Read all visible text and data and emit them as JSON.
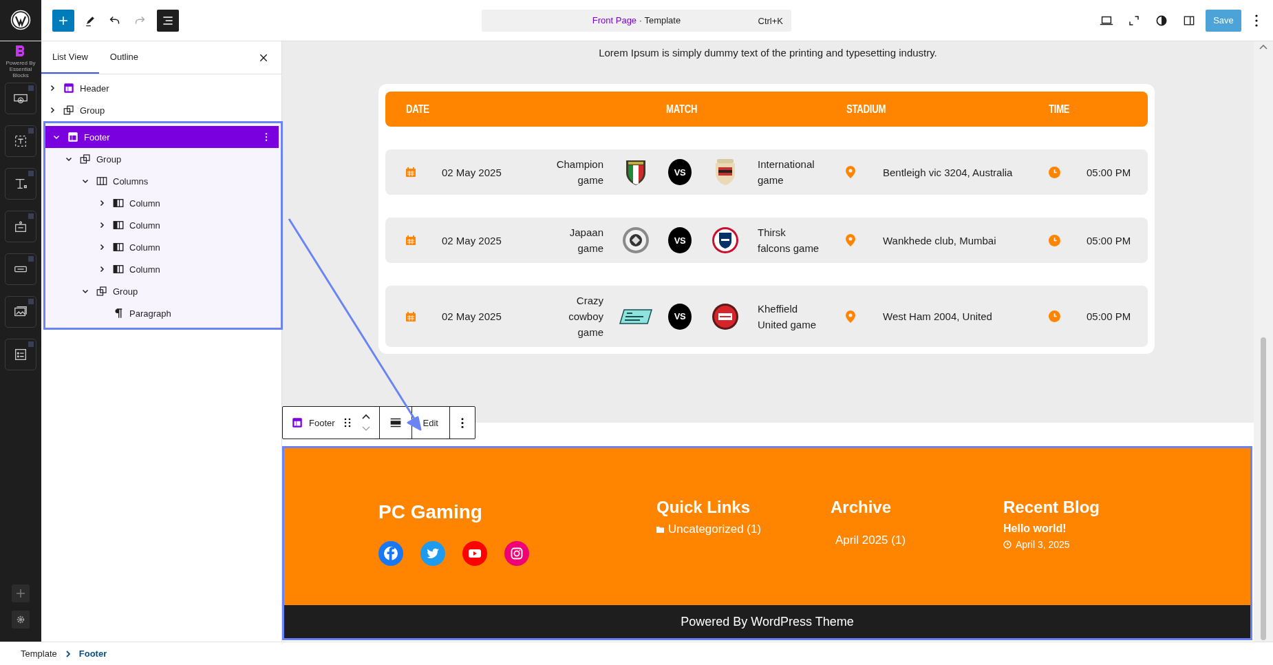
{
  "topbar": {
    "command": {
      "title": "Front Page",
      "type": "· Template",
      "shortcut": "Ctrl+K"
    },
    "redo": {
      "disabled": true
    },
    "list_view_toggle": {
      "pressed": true
    },
    "save": {
      "label": "Save",
      "disabled": true
    }
  },
  "rail": {
    "brand": "Powered By Essential Blocks"
  },
  "list_view": {
    "tabs": [
      {
        "label": "List View",
        "selected": true
      },
      {
        "label": "Outline",
        "selected": false
      }
    ],
    "tree": [
      {
        "label": "Header",
        "kind": "template-part",
        "expanded": false,
        "selected": false
      },
      {
        "label": "Group",
        "kind": "group",
        "expanded": false,
        "selected": false
      },
      {
        "label": "Footer",
        "kind": "template-part",
        "expanded": true,
        "selected": true,
        "children": [
          {
            "label": "Group",
            "kind": "group",
            "expanded": true,
            "selected": false,
            "children": [
              {
                "label": "Columns",
                "kind": "columns",
                "expanded": true,
                "selected": false,
                "children": [
                  {
                    "label": "Column",
                    "kind": "column",
                    "expanded": false,
                    "selected": false
                  },
                  {
                    "label": "Column",
                    "kind": "column",
                    "expanded": false,
                    "selected": false
                  },
                  {
                    "label": "Column",
                    "kind": "column",
                    "expanded": false,
                    "selected": false
                  },
                  {
                    "label": "Column",
                    "kind": "column",
                    "expanded": false,
                    "selected": false
                  }
                ]
              },
              {
                "label": "Group",
                "kind": "group",
                "expanded": true,
                "selected": false,
                "children": [
                  {
                    "label": "Paragraph",
                    "kind": "paragraph",
                    "selected": false
                  }
                ]
              }
            ]
          }
        ]
      }
    ]
  },
  "canvas": {
    "intro": "Lorem Ipsum is simply dummy text of the printing and typesetting industry.",
    "table": {
      "columns": [
        "DATE",
        "MATCH",
        "STADIUM",
        "TIME"
      ],
      "rows": [
        {
          "date": "02 May 2025",
          "home": "Champion game",
          "vs": "VS",
          "away": "International game",
          "stadium": "Bentleigh vic 3204, Australia",
          "time": "05:00 PM"
        },
        {
          "date": "02 May 2025",
          "home": "Japaan game",
          "vs": "VS",
          "away": "Thirsk falcons game",
          "stadium": "Wankhede club, Mumbai",
          "time": "05:00 PM"
        },
        {
          "date": "02 May 2025",
          "home": "Crazy cowboy game",
          "vs": "VS",
          "away": "Kheffield United game",
          "stadium": "West Ham 2004, United",
          "time": "05:00 PM"
        }
      ]
    },
    "block_toolbar": {
      "block": "Footer",
      "edit": "Edit"
    },
    "footer": {
      "title": "PC Gaming",
      "social": [
        {
          "kind": "facebook"
        },
        {
          "kind": "twitter"
        },
        {
          "kind": "youtube"
        },
        {
          "kind": "instagram"
        }
      ],
      "columns": [
        {
          "heading": "Quick Links",
          "links": [
            {
              "kind": "category",
              "label": "Uncategorized (1)"
            }
          ]
        },
        {
          "heading": "Archive",
          "links": [
            {
              "kind": "archive",
              "label": "April 2025 (1)"
            }
          ]
        },
        {
          "heading": "Recent Blog",
          "links": [
            {
              "kind": "post",
              "label": "Hello world!"
            },
            {
              "kind": "date",
              "label": "April 3, 2025"
            }
          ]
        }
      ],
      "copyright": "Powered By WordPress Theme"
    }
  },
  "breadcrumb": [
    {
      "label": "Template",
      "current": false
    },
    {
      "label": "Footer",
      "current": true
    }
  ]
}
